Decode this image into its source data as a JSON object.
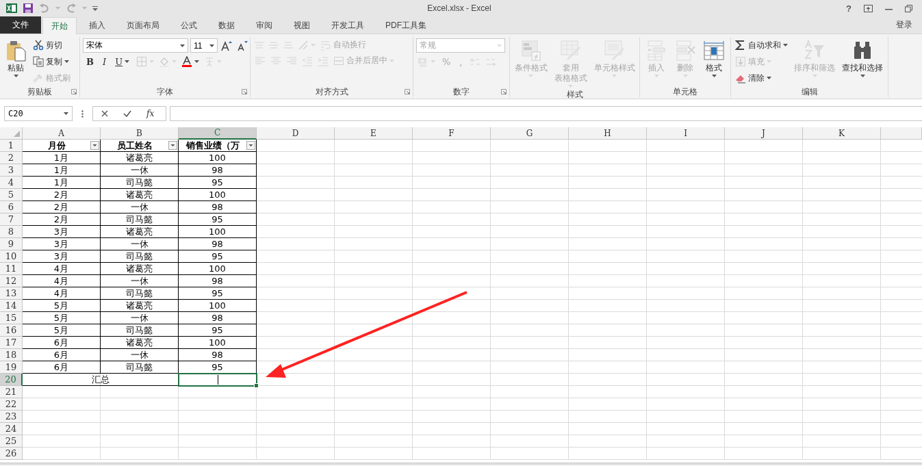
{
  "window": {
    "title": "Excel.xlsx - Excel",
    "help_button": "?"
  },
  "tabs": [
    {
      "label": "文件",
      "kind": "file",
      "selected": false
    },
    {
      "label": "开始",
      "kind": "tab",
      "selected": true
    },
    {
      "label": "插入",
      "kind": "tab",
      "selected": false
    },
    {
      "label": "页面布局",
      "kind": "tab",
      "selected": false
    },
    {
      "label": "公式",
      "kind": "tab",
      "selected": false
    },
    {
      "label": "数据",
      "kind": "tab",
      "selected": false
    },
    {
      "label": "审阅",
      "kind": "tab",
      "selected": false
    },
    {
      "label": "视图",
      "kind": "tab",
      "selected": false
    },
    {
      "label": "开发工具",
      "kind": "tab",
      "selected": false
    },
    {
      "label": "PDF工具集",
      "kind": "tab",
      "selected": false
    }
  ],
  "account": "登录",
  "ribbon": {
    "groups": [
      {
        "name": "剪贴板",
        "launcher": true,
        "items": [
          {
            "kind": "large",
            "label": "粘贴",
            "disabled": false,
            "dropdown": true
          },
          {
            "kind": "stack",
            "items": [
              {
                "kind": "small",
                "label": "剪切",
                "disabled": false
              },
              {
                "kind": "small",
                "label": "复制",
                "disabled": false,
                "dropdown": true
              },
              {
                "kind": "small",
                "label": "格式刷",
                "disabled": true
              }
            ]
          }
        ]
      },
      {
        "name": "字体",
        "launcher": true,
        "items": [
          {
            "kind": "stack",
            "items": [
              {
                "kind": "row",
                "items": [
                  {
                    "kind": "combo",
                    "value": "宋体",
                    "disabled": false
                  },
                  {
                    "kind": "combo",
                    "value": "11",
                    "disabled": false
                  },
                  {
                    "kind": "icon",
                    "disabled": false
                  },
                  {
                    "kind": "icon",
                    "disabled": false
                  }
                ]
              },
              {
                "kind": "row",
                "items": [
                  {
                    "kind": "glyph",
                    "label": "B",
                    "disabled": false
                  },
                  {
                    "kind": "glyph",
                    "label": "I",
                    "disabled": false
                  },
                  {
                    "kind": "glyph",
                    "label": "U",
                    "disabled": false,
                    "dropdown": true
                  },
                  {
                    "kind": "icon",
                    "disabled": true,
                    "dropdown": true
                  },
                  {
                    "kind": "icon",
                    "disabled": true,
                    "dropdown": true
                  },
                  {
                    "kind": "icon",
                    "disabled": false,
                    "dropdown": true
                  },
                  {
                    "kind": "icon",
                    "disabled": true,
                    "dropdown": true
                  }
                ]
              }
            ]
          }
        ]
      },
      {
        "name": "对齐方式",
        "launcher": true,
        "items": [
          {
            "kind": "stack",
            "items": [
              {
                "kind": "row",
                "items": [
                  {
                    "kind": "icon",
                    "disabled": true
                  },
                  {
                    "kind": "icon",
                    "disabled": true
                  },
                  {
                    "kind": "icon",
                    "disabled": true
                  },
                  {
                    "kind": "icon",
                    "disabled": true,
                    "dropdown": true
                  },
                  {
                    "kind": "small",
                    "label": "自动换行",
                    "disabled": true
                  }
                ]
              },
              {
                "kind": "row",
                "items": [
                  {
                    "kind": "icon",
                    "disabled": true
                  },
                  {
                    "kind": "icon",
                    "disabled": true
                  },
                  {
                    "kind": "icon",
                    "disabled": true
                  },
                  {
                    "kind": "icon",
                    "disabled": true
                  },
                  {
                    "kind": "icon",
                    "disabled": true
                  },
                  {
                    "kind": "small",
                    "label": "合并后居中",
                    "disabled": true,
                    "dropdown": true
                  }
                ]
              }
            ]
          }
        ]
      },
      {
        "name": "数字",
        "launcher": true,
        "items": [
          {
            "kind": "stack",
            "items": [
              {
                "kind": "combo",
                "value": "常规",
                "disabled": true
              },
              {
                "kind": "row",
                "items": [
                  {
                    "kind": "icon",
                    "disabled": true,
                    "dropdown": true
                  },
                  {
                    "kind": "glyph",
                    "label": "%",
                    "disabled": true
                  },
                  {
                    "kind": "glyph",
                    "label": ",",
                    "disabled": true
                  },
                  {
                    "kind": "icon",
                    "disabled": true
                  },
                  {
                    "kind": "icon",
                    "disabled": true
                  }
                ]
              }
            ]
          }
        ]
      },
      {
        "name": "样式",
        "items": [
          {
            "kind": "large",
            "label": "条件格式",
            "disabled": true,
            "dropdown": true
          },
          {
            "kind": "large",
            "label_lines": [
              "套用",
              "表格格式"
            ],
            "disabled": true,
            "dropdown": true
          },
          {
            "kind": "large",
            "label": "单元格样式",
            "disabled": true,
            "dropdown": true
          }
        ]
      },
      {
        "name": "单元格",
        "items": [
          {
            "kind": "large",
            "label": "插入",
            "disabled": true,
            "dropdown": true
          },
          {
            "kind": "large",
            "label": "删除",
            "disabled": true,
            "dropdown": true
          },
          {
            "kind": "large",
            "label": "格式",
            "disabled": false,
            "dropdown": true
          }
        ]
      },
      {
        "name": "编辑",
        "items": [
          {
            "kind": "stack",
            "items": [
              {
                "kind": "small",
                "label": "自动求和",
                "disabled": false,
                "dropdown": true
              },
              {
                "kind": "small",
                "label": "填充",
                "disabled": true,
                "dropdown": true
              },
              {
                "kind": "small",
                "label": "清除",
                "disabled": false,
                "dropdown": true
              }
            ]
          },
          {
            "kind": "large",
            "label": "排序和筛选",
            "disabled": true,
            "dropdown": true
          },
          {
            "kind": "large",
            "label": "查找和选择",
            "disabled": false,
            "dropdown": true
          }
        ]
      }
    ]
  },
  "formula_bar": {
    "name_box": "C20",
    "function_button": "fx"
  },
  "sheet": {
    "columns": [
      {
        "label": "A",
        "selected": false
      },
      {
        "label": "B",
        "selected": false
      },
      {
        "label": "C",
        "selected": true
      },
      {
        "label": "D",
        "selected": false
      },
      {
        "label": "E",
        "selected": false
      },
      {
        "label": "F",
        "selected": false
      },
      {
        "label": "G",
        "selected": false
      },
      {
        "label": "H",
        "selected": false
      },
      {
        "label": "I",
        "selected": false
      },
      {
        "label": "J",
        "selected": false
      },
      {
        "label": "K",
        "selected": false
      }
    ],
    "rows": [
      {
        "label": "1",
        "selected": false
      },
      {
        "label": "2",
        "selected": false
      },
      {
        "label": "3",
        "selected": false
      },
      {
        "label": "4",
        "selected": false
      },
      {
        "label": "5",
        "selected": false
      },
      {
        "label": "6",
        "selected": false
      },
      {
        "label": "7",
        "selected": false
      },
      {
        "label": "8",
        "selected": false
      },
      {
        "label": "9",
        "selected": false
      },
      {
        "label": "10",
        "selected": false
      },
      {
        "label": "11",
        "selected": false
      },
      {
        "label": "12",
        "selected": false
      },
      {
        "label": "13",
        "selected": false
      },
      {
        "label": "14",
        "selected": false
      },
      {
        "label": "15",
        "selected": false
      },
      {
        "label": "16",
        "selected": false
      },
      {
        "label": "17",
        "selected": false
      },
      {
        "label": "18",
        "selected": false
      },
      {
        "label": "19",
        "selected": false
      },
      {
        "label": "20",
        "selected": true
      },
      {
        "label": "21",
        "selected": false
      },
      {
        "label": "22",
        "selected": false
      },
      {
        "label": "23",
        "selected": false
      },
      {
        "label": "24",
        "selected": false
      },
      {
        "label": "25",
        "selected": false
      },
      {
        "label": "26",
        "selected": false
      }
    ],
    "header": [
      "月份",
      "员工姓名",
      "销售业绩（万"
    ],
    "data": [
      [
        "1月",
        "诸葛亮",
        "100"
      ],
      [
        "1月",
        "一休",
        "98"
      ],
      [
        "1月",
        "司马懿",
        "95"
      ],
      [
        "2月",
        "诸葛亮",
        "100"
      ],
      [
        "2月",
        "一休",
        "98"
      ],
      [
        "2月",
        "司马懿",
        "95"
      ],
      [
        "3月",
        "诸葛亮",
        "100"
      ],
      [
        "3月",
        "一休",
        "98"
      ],
      [
        "3月",
        "司马懿",
        "95"
      ],
      [
        "4月",
        "诸葛亮",
        "100"
      ],
      [
        "4月",
        "一休",
        "98"
      ],
      [
        "4月",
        "司马懿",
        "95"
      ],
      [
        "5月",
        "诸葛亮",
        "100"
      ],
      [
        "5月",
        "一休",
        "98"
      ],
      [
        "5月",
        "司马懿",
        "95"
      ],
      [
        "6月",
        "诸葛亮",
        "100"
      ],
      [
        "6月",
        "一休",
        "98"
      ],
      [
        "6月",
        "司马懿",
        "95"
      ]
    ],
    "total_label": "汇总"
  }
}
